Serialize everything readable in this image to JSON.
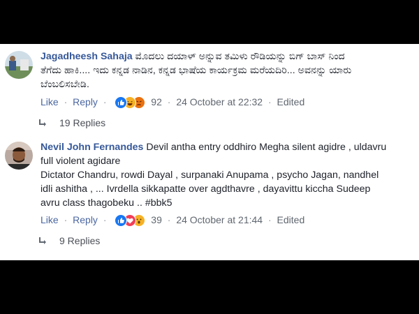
{
  "comments": [
    {
      "author": "Jagadheesh Sahaja",
      "text_line1": "ಮೊದಲು ದಯಾಳ್ ಅನ್ನುವ ತಮಿಳು ರೌಡಿಯನ್ನು ಬಿಗ್ ಬಾಸ್ ನಿಂದ",
      "text_line2": "ತೆಗೆದು ಹಾಕಿ.... ಇದು ಕನ್ನಡ ನಾಡಿನ, ಕನ್ನಡ ಭಾಷೆಯ ಕಾರ್ಯಕ್ರಮ ಮರೆಯದಿರಿ... ಅವನನ್ನು ಯಾರು",
      "text_line3": "ಬೆಂಬಲಿಸಬೇಡಿ.",
      "like": "Like",
      "reply": "Reply",
      "reaction_count": "92",
      "timestamp": "24 October at 22:32",
      "edited": "Edited",
      "replies": "19 Replies",
      "reaction_icons": [
        "like-icon",
        "haha-icon",
        "angry-icon"
      ]
    },
    {
      "author": "Nevil John Fernandes",
      "text_line1": "Devil antha entry oddhiro Megha silent agidre , uldavru",
      "text_line2": "full violent agidare",
      "text_line3": "Dictator Chandru, rowdi Dayal , surpanaki Anupama , psycho Jagan, nandhel",
      "text_line4": "idli ashitha , ... Ivrdella sikkapatte over agdthavre , dayavittu kiccha Sudeep",
      "text_line5": "avru class thagobeku .. #bbk5",
      "like": "Like",
      "reply": "Reply",
      "reaction_count": "39",
      "timestamp": "24 October at 21:44",
      "edited": "Edited",
      "replies": "9 Replies",
      "reaction_icons": [
        "like-icon",
        "love-icon",
        "wow-icon"
      ]
    }
  ],
  "colors": {
    "author": "#365899",
    "link": "#4b67a1",
    "meta": "#606770",
    "like_reaction": "#1877f2",
    "love_reaction": "#f33e58",
    "haha_reaction": "#f7b125"
  }
}
